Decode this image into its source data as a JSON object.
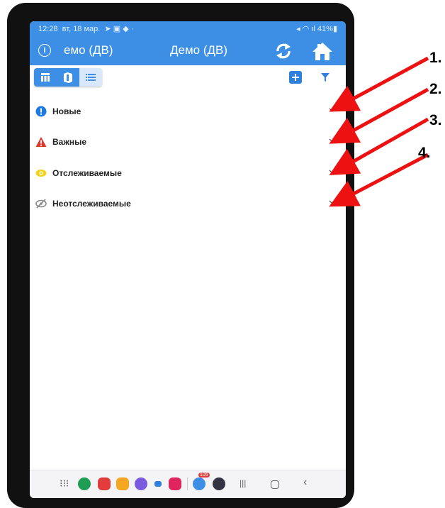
{
  "status_bar": {
    "time": "12:28",
    "date": "вт, 18 мар.",
    "battery": "41%"
  },
  "app_bar": {
    "left_title": "емо (ДВ)",
    "title": "Демо (ДВ)",
    "info_glyph": "i"
  },
  "toolbar": {
    "view_modes": [
      "table-icon",
      "map-icon",
      "list-icon"
    ],
    "active_view": "list-icon"
  },
  "categories": [
    {
      "label": "Новые",
      "icon": "new-badge-icon",
      "color": "#1e78e6"
    },
    {
      "label": "Важные",
      "icon": "warning-icon",
      "color": "#e0352b"
    },
    {
      "label": "Отслеживаемые",
      "icon": "eye-icon",
      "color": "#f2d21a"
    },
    {
      "label": "Неотслеживаемые",
      "icon": "eye-off-icon",
      "color": "#8a8a8a"
    }
  ],
  "annotations": [
    "1.",
    "2.",
    "3.",
    "4."
  ],
  "nav_bar": {
    "badge_count": "105"
  },
  "colors": {
    "accent": "#3d8fe6",
    "arrow": "#ee1111"
  }
}
